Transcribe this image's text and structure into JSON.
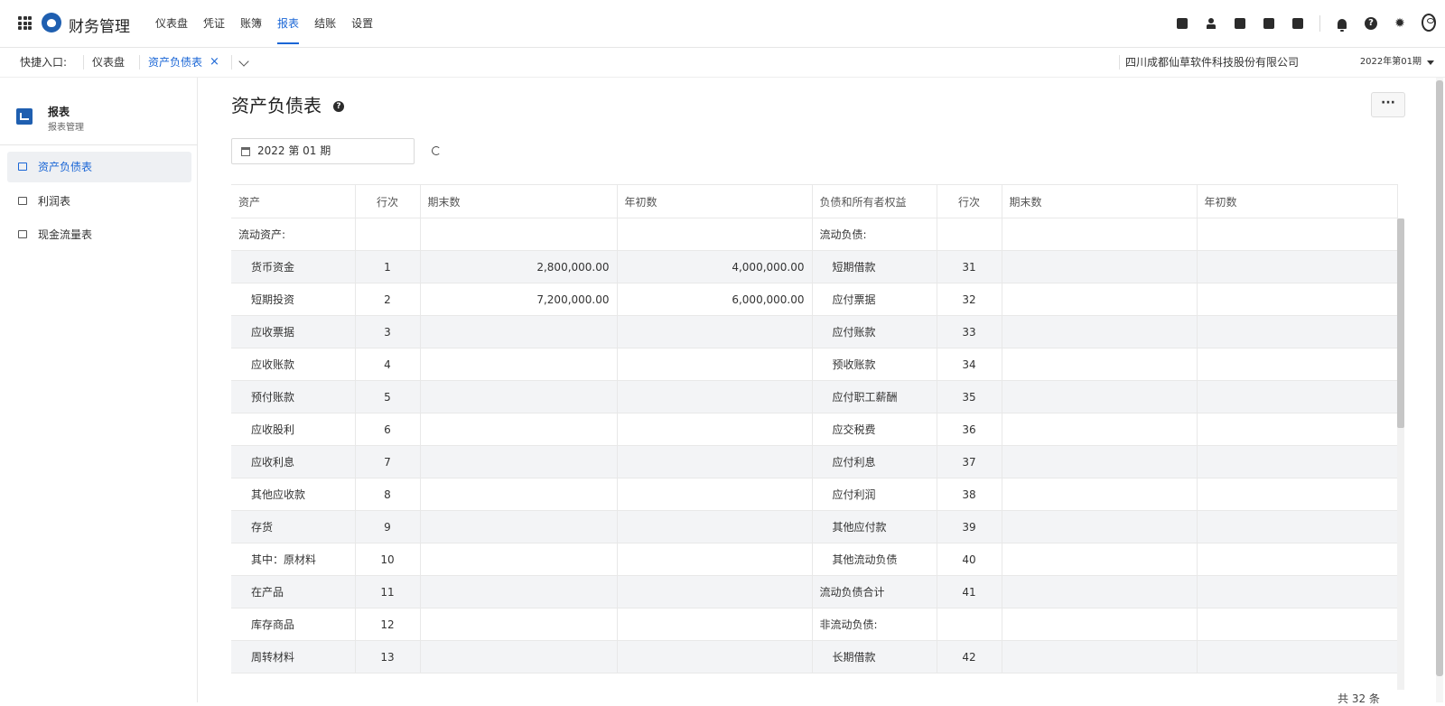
{
  "header": {
    "app_title": "财务管理",
    "nav": [
      {
        "label": "仪表盘"
      },
      {
        "label": "凭证"
      },
      {
        "label": "账簿"
      },
      {
        "label": "报表",
        "active": true
      },
      {
        "label": "结账"
      },
      {
        "label": "设置"
      }
    ],
    "tools": [
      "calendar-check-icon",
      "user-icon",
      "document-icon",
      "address-book-icon",
      "calendar-icon",
      "bell-icon",
      "help-icon",
      "gear-icon",
      "user-circle-icon"
    ]
  },
  "tabs": {
    "quick_label": "快捷入口:",
    "items": [
      {
        "label": "仪表盘"
      },
      {
        "label": "资产负债表",
        "active": true
      }
    ],
    "close_glyph": "×",
    "company": "四川成都仙草软件科技股份有限公司",
    "period": "2022年第01期"
  },
  "sidebar": {
    "module_title": "报表",
    "module_sub": "报表管理",
    "items": [
      {
        "label": "资产负债表",
        "active": true
      },
      {
        "label": "利润表"
      },
      {
        "label": "现金流量表"
      }
    ]
  },
  "main": {
    "title": "资产负债表",
    "more_label": "···",
    "date_value": "2022 第 01 期",
    "total": "共 32 条",
    "columns": [
      "资产",
      "行次",
      "期末数",
      "年初数",
      "负债和所有者权益",
      "行次",
      "期末数",
      "年初数"
    ],
    "rows": [
      {
        "a": "流动资产:",
        "an": "",
        "ae": "",
        "ab": "",
        "l": "流动负债:",
        "ln": "",
        "le": "",
        "lb": ""
      },
      {
        "a": "货币资金",
        "an": "1",
        "ae": "2,800,000.00",
        "ab": "4,000,000.00",
        "l": "短期借款",
        "ln": "31",
        "le": "",
        "lb": ""
      },
      {
        "a": "短期投资",
        "an": "2",
        "ae": "7,200,000.00",
        "ab": "6,000,000.00",
        "l": "应付票据",
        "ln": "32",
        "le": "",
        "lb": ""
      },
      {
        "a": "应收票据",
        "an": "3",
        "ae": "",
        "ab": "",
        "l": "应付账款",
        "ln": "33",
        "le": "",
        "lb": ""
      },
      {
        "a": "应收账款",
        "an": "4",
        "ae": "",
        "ab": "",
        "l": "预收账款",
        "ln": "34",
        "le": "",
        "lb": ""
      },
      {
        "a": "预付账款",
        "an": "5",
        "ae": "",
        "ab": "",
        "l": "应付职工薪酬",
        "ln": "35",
        "le": "",
        "lb": ""
      },
      {
        "a": "应收股利",
        "an": "6",
        "ae": "",
        "ab": "",
        "l": "应交税费",
        "ln": "36",
        "le": "",
        "lb": ""
      },
      {
        "a": "应收利息",
        "an": "7",
        "ae": "",
        "ab": "",
        "l": "应付利息",
        "ln": "37",
        "le": "",
        "lb": ""
      },
      {
        "a": "其他应收款",
        "an": "8",
        "ae": "",
        "ab": "",
        "l": "应付利润",
        "ln": "38",
        "le": "",
        "lb": ""
      },
      {
        "a": "存货",
        "an": "9",
        "ae": "",
        "ab": "",
        "l": "其他应付款",
        "ln": "39",
        "le": "",
        "lb": ""
      },
      {
        "a": "其中：原材料",
        "an": "10",
        "ae": "",
        "ab": "",
        "l": "其他流动负债",
        "ln": "40",
        "le": "",
        "lb": ""
      },
      {
        "a": "在产品",
        "an": "11",
        "ae": "",
        "ab": "",
        "l": "流动负债合计",
        "ln": "41",
        "le": "",
        "lb": ""
      },
      {
        "a": "库存商品",
        "an": "12",
        "ae": "",
        "ab": "",
        "l": "非流动负债:",
        "ln": "",
        "le": "",
        "lb": ""
      },
      {
        "a": "周转材料",
        "an": "13",
        "ae": "",
        "ab": "",
        "l": "长期借款",
        "ln": "42",
        "le": "",
        "lb": ""
      }
    ]
  },
  "colors": {
    "accent": "#1a66d6",
    "brand": "#1f5fb0",
    "row_stripe": "#f3f4f6"
  }
}
